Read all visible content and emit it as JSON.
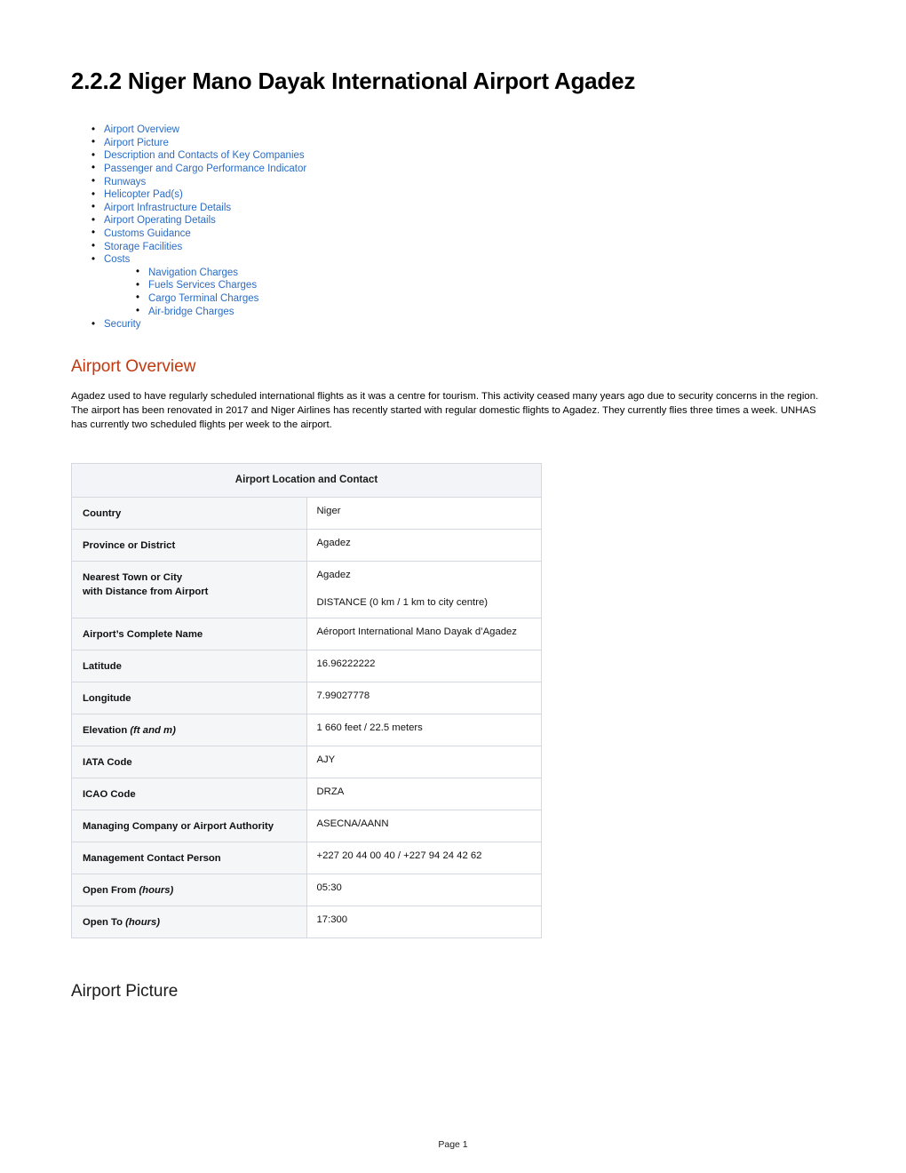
{
  "document": {
    "title": "2.2.2 Niger Mano Dayak International Airport Agadez",
    "footer": "Page 1"
  },
  "toc": {
    "items": [
      {
        "label": "Airport Overview"
      },
      {
        "label": "Airport Picture"
      },
      {
        "label": "Description and Contacts of Key Companies"
      },
      {
        "label": "Passenger and Cargo Performance Indicator"
      },
      {
        "label": "Runways"
      },
      {
        "label": "Helicopter Pad(s)"
      },
      {
        "label": "Airport Infrastructure Details"
      },
      {
        "label": "Airport Operating Details"
      },
      {
        "label": "Customs Guidance"
      },
      {
        "label": "Storage Facilities"
      },
      {
        "label": "Costs"
      },
      {
        "label": "Security"
      }
    ],
    "sub_items": [
      {
        "label": "Navigation Charges"
      },
      {
        "label": "Fuels Services Charges"
      },
      {
        "label": "Cargo Terminal Charges"
      },
      {
        "label": "Air-bridge Charges"
      }
    ]
  },
  "sections": {
    "overview": {
      "heading": "Airport Overview",
      "paragraph": "Agadez used to have regularly scheduled international flights as it was a centre for tourism. This activity ceased many years ago due to security concerns in the region. The airport has been renovated in 2017 and Niger Airlines has recently started with regular domestic flights to Agadez. They currently flies three times a week. UNHAS has currently two scheduled flights per week to the airport."
    },
    "picture": {
      "heading": "Airport Picture"
    }
  },
  "table": {
    "header": "Airport Location and Contact",
    "rows": [
      {
        "key": "Country",
        "value": "Niger"
      },
      {
        "key": "Province or District",
        "value": "Agadez"
      },
      {
        "key_line1": "Nearest Town or City",
        "key_line2": "with Distance from Airport",
        "value_line1": "Agadez",
        "value_line2": "DISTANCE (0 km / 1 km to city centre)"
      },
      {
        "key": "Airport’s Complete Name",
        "value": "Aéroport International Mano Dayak d’Agadez"
      },
      {
        "key": "Latitude",
        "value": "16.96222222"
      },
      {
        "key": "Longitude",
        "value": "7.99027778"
      },
      {
        "key": "Elevation",
        "key_italic": "(ft and m)",
        "value": "1 660 feet / 22.5 meters"
      },
      {
        "key": "IATA Code",
        "value": "AJY"
      },
      {
        "key": "ICAO Code",
        "value": "DRZA"
      },
      {
        "key": "Managing Company or Airport Authority",
        "value": "ASECNA/AANN"
      },
      {
        "key": "Management Contact Person",
        "value": "+227 20 44 00 40 / +227 94 24 42 62"
      },
      {
        "key": "Open From",
        "key_italic": "(hours)",
        "value": "05:30"
      },
      {
        "key": "Open To",
        "key_italic": "(hours)",
        "value": "17:300"
      }
    ]
  },
  "colors": {
    "link": "#2b6cc4",
    "heading_accent": "#c1390f",
    "table_header_bg": "#f2f4f7",
    "table_key_bg": "#f4f6f8",
    "table_border": "#d4d9e0"
  }
}
